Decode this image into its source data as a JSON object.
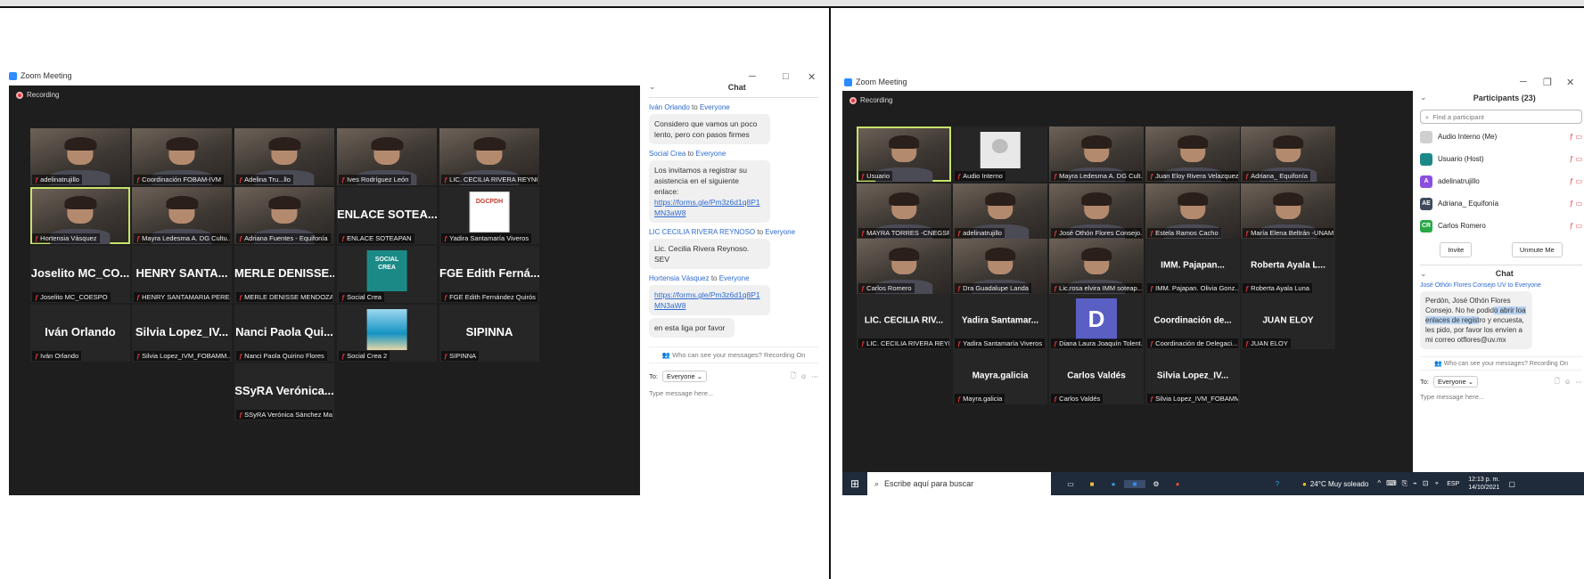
{
  "left": {
    "title": "Zoom Meeting",
    "recording": "Recording",
    "tiles": [
      {
        "name": "",
        "label": "adelinatrujillo",
        "cam": true
      },
      {
        "name": "",
        "label": "Coordinación FOBAM-IVM",
        "cam": true
      },
      {
        "name": "",
        "label": "Adelina Tru...llo",
        "cam": true
      },
      {
        "name": "",
        "label": "Ives Rodríguez León",
        "cam": true
      },
      {
        "name": "",
        "label": "LIC. CECILIA RIVERA REYNOSO",
        "cam": true
      },
      {
        "name": "",
        "label": "Hortensia Vásquez",
        "cam": true,
        "active": true
      },
      {
        "name": "",
        "label": "Mayra Ledesma A. DG Cultu...",
        "cam": true
      },
      {
        "name": "",
        "label": "Adriana Fuentes - Equifonía",
        "cam": true
      },
      {
        "name": "ENLACE SOTEA...",
        "label": "ENLACE SOTEAPAN"
      },
      {
        "name": "",
        "label": "Yadira Santamaría Viveros",
        "logo": "DGCPDH"
      },
      {
        "name": "Joselito MC_CO...",
        "label": "Joselito MC_COESPO"
      },
      {
        "name": "HENRY SANTA...",
        "label": "HENRY SANTAMARIA PEREZ"
      },
      {
        "name": "MERLE DENISSE...",
        "label": "MERLE DENISSE MENDOZA ..."
      },
      {
        "name": "",
        "label": "Social Crea",
        "logo": "SOCIAL CREA"
      },
      {
        "name": "FGE Edith Ferná...",
        "label": "FGE Edith Fernández Quirós"
      },
      {
        "name": "Iván Orlando",
        "label": "Iván Orlando"
      },
      {
        "name": "Silvia Lopez_IV...",
        "label": "Silvia Lopez_IVM_FOBAMM..."
      },
      {
        "name": "Nanci Paola Qui...",
        "label": "Nanci Paola Quirino Flores"
      },
      {
        "name": "",
        "label": "Social Crea 2",
        "logo": "sea"
      },
      {
        "name": "SIPINNA",
        "label": "SIPINNA"
      },
      {
        "name": "SSyRA Verónica...",
        "label": "SSyRA Verónica Sánchez Ma..."
      }
    ],
    "chat": {
      "header": "Chat",
      "messages": [
        {
          "from": "Iván Orlando",
          "to": "Everyone",
          "lines": [
            "Considero que vamos un poco lento, pero con pasos firmes"
          ]
        },
        {
          "from": "Social Crea",
          "to": "Everyone",
          "lines": [
            "Los invitamos a registrar su asistencia en el siguiente enlace:"
          ],
          "link": "https://forms.gle/Pm3z6d1q8P1MN3aW8"
        },
        {
          "from": "LIC CECILIA RIVERA REYNOSO",
          "to": "Everyone",
          "lines": [
            "Lic. Cecilia Rivera Reynoso. SEV"
          ]
        },
        {
          "from": "Hortensia Vásquez",
          "to": "Everyone",
          "link": "https://forms.gle/Pm3z6d1q8P1MN3aW8",
          "extra": "en esta liga por favor"
        }
      ],
      "who_can_see": "Who can see your messages? Recording On",
      "to_label": "To:",
      "to_value": "Everyone",
      "placeholder": "Type message here..."
    }
  },
  "right": {
    "title": "Zoom Meeting",
    "recording": "Recording",
    "tiles": [
      {
        "name": "",
        "label": "Usuario",
        "cam": true,
        "active": true
      },
      {
        "name": "",
        "label": "Audio Interno",
        "avatar": true
      },
      {
        "name": "",
        "label": "Mayra Ledesma A. DG Cult...",
        "cam": true
      },
      {
        "name": "",
        "label": "Juan Eloy Rivera Velazquez",
        "cam": true
      },
      {
        "name": "",
        "label": "Adriana_ Equifonía",
        "cam": true
      },
      {
        "name": "",
        "label": "MAYRA TORRES -CNEGSR",
        "cam": true
      },
      {
        "name": "",
        "label": "adelinatrujillo",
        "cam": true
      },
      {
        "name": "",
        "label": "José Othón Flores Consejo...",
        "cam": true
      },
      {
        "name": "",
        "label": "Estela Ramos Cacho",
        "cam": true
      },
      {
        "name": "",
        "label": "María Elena Beltrán -UNAM",
        "cam": true
      },
      {
        "name": "",
        "label": "Carlos Romero",
        "cam": true
      },
      {
        "name": "",
        "label": "Dra Guadalupe Landa",
        "cam": true
      },
      {
        "name": "",
        "label": "Lic.rosa elvira IMM soteap...",
        "cam": true
      },
      {
        "name": "IMM. Pajapan...",
        "label": "IMM. Pajapan. Olivia Gonz..."
      },
      {
        "name": "Roberta Ayala L...",
        "label": "Roberta Ayala Luna"
      },
      {
        "name": "LIC. CECILIA RIV...",
        "label": "LIC. CECILIA RIVERA REYN..."
      },
      {
        "name": "Yadira Santamar...",
        "label": "Yadira Santamaría Viveros"
      },
      {
        "name": "D",
        "label": "Diana Laura Joaquín Tolent...",
        "letter": true
      },
      {
        "name": "Coordinación de...",
        "label": "Coordinación de Delegaci..."
      },
      {
        "name": "JUAN ELOY",
        "label": "JUAN ELOY"
      },
      {
        "name": "Mayra.galicia",
        "label": "Mayra.galicia"
      },
      {
        "name": "Carlos Valdés",
        "label": "Carlos Valdés"
      },
      {
        "name": "Silvia Lopez_IV...",
        "label": "Silvia Lopez_IVM_FOBAMM..."
      }
    ],
    "participants": {
      "header": "Participants (23)",
      "search_placeholder": "Find a participant",
      "list": [
        {
          "initials": "",
          "name": "Audio Interno (Me)",
          "color": "#cfcfcf"
        },
        {
          "initials": "",
          "name": "Usuario (Host)",
          "color": "#1b8a86"
        },
        {
          "initials": "A",
          "name": "adelinatrujillo",
          "color": "#8a4fe0"
        },
        {
          "initials": "AE",
          "name": "Adriana_ Equifonía",
          "color": "#3c4a5c"
        },
        {
          "initials": "CR",
          "name": "Carlos Romero",
          "color": "#28a745"
        }
      ],
      "invite": "Invite",
      "unmute": "Unmute Me"
    },
    "chat": {
      "header": "Chat",
      "from_line": "José Othón Flores Consejo UV to Everyone",
      "message": "Perdón, José Othón Flores Consejo. No he podido abrir loa enlaces de registro y encuesta, les pido, por favor los envíen a mi correo otflores@uv.mx",
      "who_can_see": "Who can see your messages? Recording On",
      "to_label": "To:",
      "to_value": "Everyone",
      "placeholder": "Type message here..."
    },
    "taskbar": {
      "search": "Escribe aquí para buscar",
      "weather": "24°C  Muy soleado",
      "lang": "ESP",
      "time": "12:13 p. m.",
      "date": "14/10/2021"
    }
  }
}
